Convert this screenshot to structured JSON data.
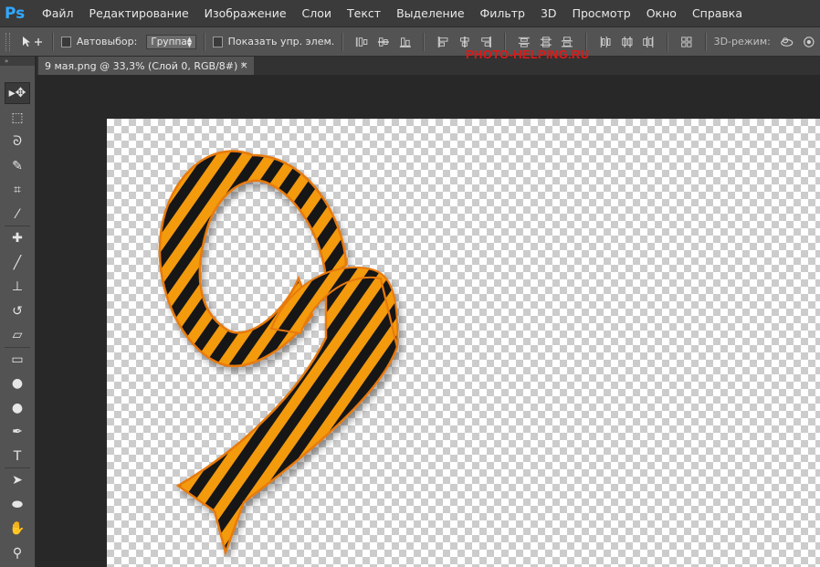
{
  "app": {
    "logo": "Ps",
    "menu": [
      "Файл",
      "Редактирование",
      "Изображение",
      "Слои",
      "Текст",
      "Выделение",
      "Фильтр",
      "3D",
      "Просмотр",
      "Окно",
      "Справка"
    ]
  },
  "options": {
    "autoselect_label": "Автовыбор:",
    "autoselect_value": "Группа",
    "show_controls_label": "Показать упр. элем.",
    "mode_3d_label": "3D-режим:"
  },
  "document": {
    "tab_title": "9 мая.png @ 33,3% (Слой 0, RGB/8#) *",
    "close_glyph": "×"
  },
  "watermark": "PHOTO-HELPING.RU",
  "toolbar": {
    "collapse_glyph": "» ",
    "tools": [
      {
        "name": "move-tool",
        "icon": "move-icon",
        "glyph": "▸✥",
        "active": true
      },
      {
        "name": "marquee-tool",
        "icon": "rect-marquee-icon",
        "glyph": "⬚"
      },
      {
        "name": "lasso-tool",
        "icon": "lasso-icon",
        "glyph": "ᘐ"
      },
      {
        "name": "quick-select-tool",
        "icon": "quick-select-icon",
        "glyph": "✎"
      },
      {
        "name": "crop-tool",
        "icon": "crop-icon",
        "glyph": "⌗"
      },
      {
        "name": "eyedropper-tool",
        "icon": "eyedropper-icon",
        "glyph": "⁄"
      },
      {
        "name": "healing-tool",
        "icon": "bandage-icon",
        "glyph": "✚"
      },
      {
        "name": "brush-tool",
        "icon": "brush-icon",
        "glyph": "╱"
      },
      {
        "name": "stamp-tool",
        "icon": "stamp-icon",
        "glyph": "⊥"
      },
      {
        "name": "history-brush-tool",
        "icon": "history-brush-icon",
        "glyph": "↺"
      },
      {
        "name": "eraser-tool",
        "icon": "eraser-icon",
        "glyph": "▱"
      },
      {
        "name": "gradient-tool",
        "icon": "gradient-icon",
        "glyph": "▭"
      },
      {
        "name": "blur-tool",
        "icon": "drop-icon",
        "glyph": "●"
      },
      {
        "name": "dodge-tool",
        "icon": "dodge-icon",
        "glyph": "●"
      },
      {
        "name": "pen-tool",
        "icon": "pen-icon",
        "glyph": "✒"
      },
      {
        "name": "type-tool",
        "icon": "type-icon",
        "glyph": "T"
      },
      {
        "name": "path-select-tool",
        "icon": "path-select-icon",
        "glyph": "➤"
      },
      {
        "name": "shape-tool",
        "icon": "ellipse-icon",
        "glyph": "⬬"
      },
      {
        "name": "hand-tool",
        "icon": "hand-icon",
        "glyph": "✋"
      },
      {
        "name": "zoom-tool",
        "icon": "zoom-icon",
        "glyph": "⚲"
      }
    ]
  },
  "colors": {
    "ribbon_orange": "#f39a0e",
    "ribbon_black": "#151515",
    "app_dark": "#282828",
    "panel": "#535353"
  }
}
